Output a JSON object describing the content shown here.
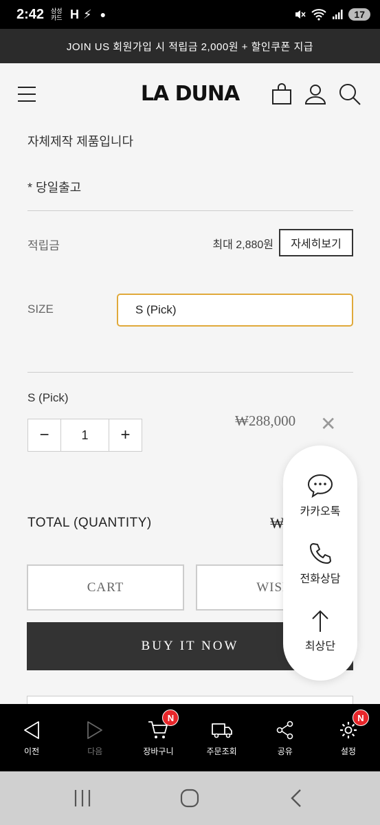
{
  "status_bar": {
    "time": "2:42",
    "card_text": "삼성 카드",
    "h_glyph": "H",
    "battery_level": "17"
  },
  "promo": {
    "text": "JOIN US 회원가입 시 적립금 2,000원 + 할인쿠폰 지급"
  },
  "header": {
    "logo": "LA DUNA",
    "icons": [
      "menu-icon",
      "cart-icon",
      "user-icon",
      "search-icon"
    ]
  },
  "product": {
    "note1": "자체제작 제품입니다",
    "note2": "* 당일출고"
  },
  "points": {
    "label": "적립금",
    "value": "최대 2,880원",
    "detail_button": "자세히보기"
  },
  "size": {
    "label": "SIZE",
    "selected": "S (Pick)"
  },
  "selected_option": {
    "name": "S (Pick)",
    "quantity": "1",
    "minus": "−",
    "plus": "+",
    "price": "₩288,000",
    "remove": "✕"
  },
  "total": {
    "label": "TOTAL (QUANTITY)",
    "value_partial": "₩"
  },
  "buttons": {
    "cart": "CART",
    "wish": "WISH",
    "buy": "BUY IT NOW"
  },
  "floating_menu": {
    "kakao": "카카오톡",
    "phone": "전화상담",
    "top": "최상단"
  },
  "browser_toolbar": {
    "back": "이전",
    "forward": "다음",
    "cart": "장바구니",
    "cart_badge": "N",
    "order": "주문조회",
    "share": "공유",
    "settings": "설정",
    "settings_badge": "N"
  },
  "colors": {
    "select_border": "#e0a93a",
    "badge": "#e8262a",
    "buy_button": "#333333"
  }
}
